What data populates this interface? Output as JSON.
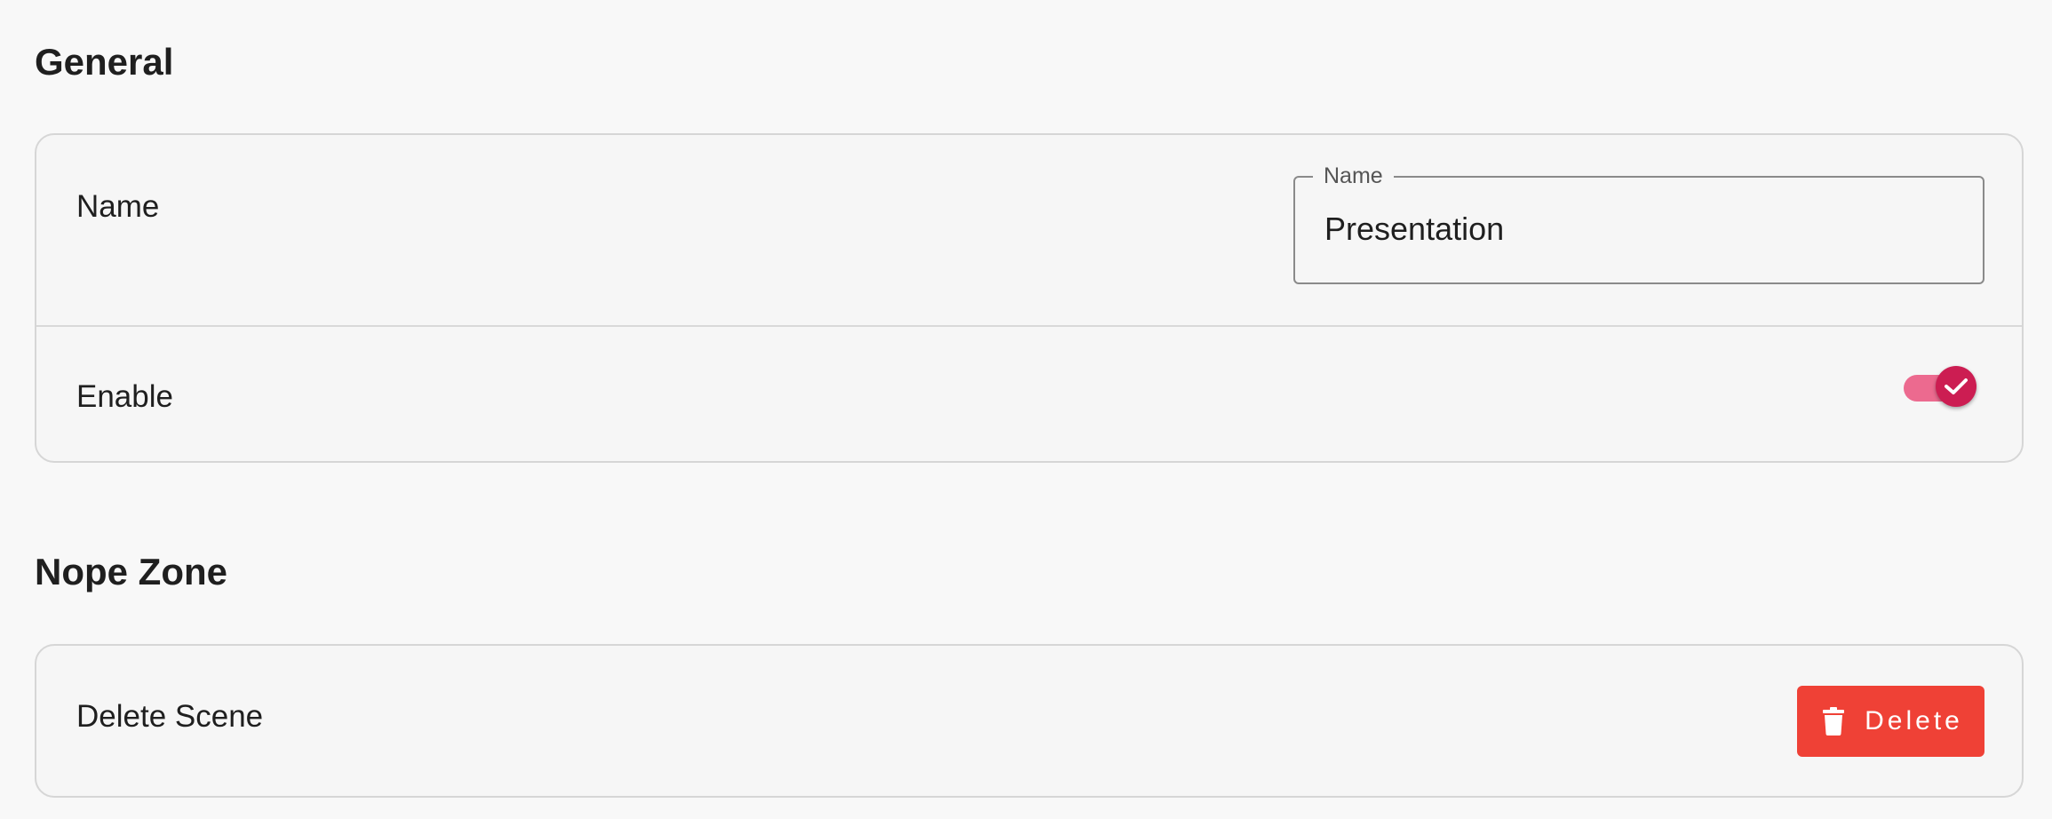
{
  "general": {
    "title": "General",
    "name_row": {
      "label": "Name",
      "field_label": "Name",
      "field_value": "Presentation"
    },
    "enable_row": {
      "label": "Enable",
      "enabled": true
    }
  },
  "nope_zone": {
    "title": "Nope Zone",
    "delete_row": {
      "label": "Delete Scene",
      "button_label": "Delete",
      "button_icon": "trash-icon"
    }
  },
  "colors": {
    "accent": "#cc1d52",
    "accent_track": "#ec6a8f",
    "danger": "#ef4136"
  }
}
